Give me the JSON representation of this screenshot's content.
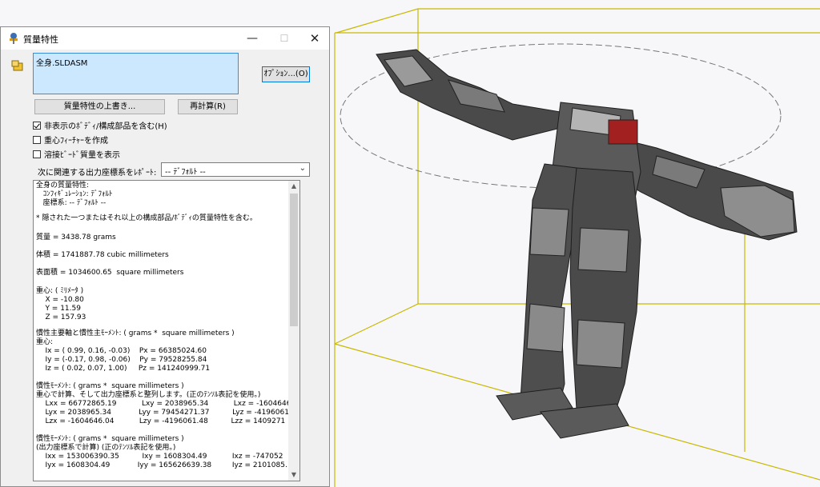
{
  "dialog": {
    "title": "質量特性",
    "minimize_glyph": "—",
    "maximize_glyph": "☐",
    "close_glyph": "✕",
    "file_item": "全身.SLDASM",
    "options_label": "ｵﾌﾟｼｮﾝ...(O)",
    "overwrite_label": "質量特性の上書き...",
    "recalculate_label": "再計算(R)",
    "include_hidden_label": "非表示のﾎﾞﾃﾞｨ/構成部品を含む(H)",
    "include_hidden_checked": true,
    "create_cog_label": "重心ﾌｨｰﾁｬｰを作成",
    "create_cog_checked": false,
    "show_weld_label": "溶接ﾋﾞｰﾄﾞ質量を表示",
    "show_weld_checked": false,
    "report_label": "次に関連する出力座標系をﾚﾎﾟｰﾄ:",
    "coordinate_system_value": "-- ﾃﾞﾌｫﾙﾄ --",
    "icons": [
      "app-icon",
      "assembly-icon",
      "dropdown-arrow-icon",
      "scroll-up-icon",
      "scroll-down-icon"
    ]
  },
  "results": {
    "lines": [
      "全身の質量特性:",
      "   ｺﾝﾌｨｷﾞｭﾚｰｼｮﾝ: ﾃﾞﾌｫﾙﾄ",
      "   座標系: -- ﾃﾞﾌｫﾙﾄ --",
      "* 隠された一つまたはそれ以上の構成部品/ﾎﾞﾃﾞｨの質量特性を含む。",
      "質量 = 3438.78 grams",
      "体積 = 1741887.78 cubic millimeters",
      "表面積 = 1034600.65  square millimeters",
      "重心: ( ﾐﾘﾒｰﾀ )",
      "    X = -10.80",
      "    Y = 11.59",
      "    Z = 157.93",
      "慣性主要軸と慣性主ﾓｰﾒﾝﾄ: ( grams *  square millimeters )",
      "重心:",
      "    Ix = ( 0.99, 0.16, -0.03)    Px = 66385024.60",
      "    Iy = (-0.17, 0.98, -0.06)    Py = 79528255.84",
      "    Iz = ( 0.02, 0.07, 1.00)     Pz = 141240999.71",
      "慣性ﾓｰﾒﾝﾄ: ( grams *  square millimeters )",
      "重心で計算、そして出力座標系と整列します。(正のﾃﾝｿﾙ表記を使用。)",
      "    Lxx = 66772865.19           Lxy = 2038965.34           Lxz = -1604646",
      "    Lyx = 2038965.34            Lyy = 79454271.37          Lyz = -4196061",
      "    Lzx = -1604646.04           Lzy = -4196061.48          Lzz = 1409271",
      "慣性ﾓｰﾒﾝﾄ: ( grams *  square millimeters )",
      "(出力座標系で計算) (正のﾃﾝｿﾙ表記を使用。)",
      "    Ixx = 153006390.35          Ixy = 1608304.49           Ixz = -747052",
      "    Iyx = 1608304.49            Iyy = 165626639.38         Iyz = 2101085."
    ]
  }
}
